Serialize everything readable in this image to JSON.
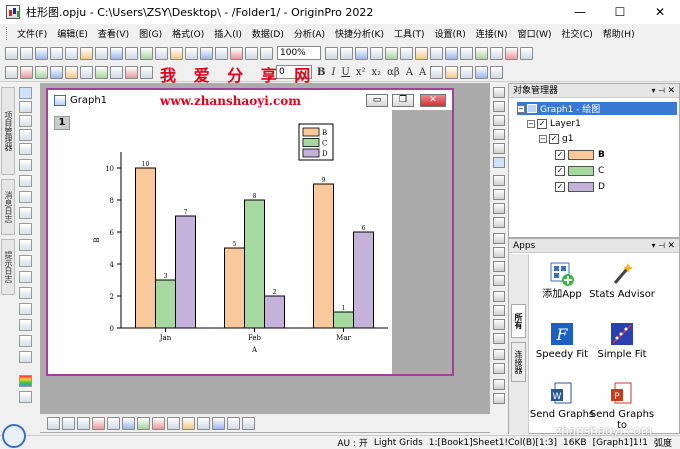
{
  "window": {
    "title": "柱形图.opju - C:\\Users\\ZSY\\Desktop\\ - /Folder1/ - OriginPro 2022",
    "min": "—",
    "max": "☐",
    "close": "✕"
  },
  "menu": [
    "文件(F)",
    "编辑(E)",
    "查看(V)",
    "图(G)",
    "格式(O)",
    "插入(I)",
    "数据(D)",
    "分析(A)",
    "快捷分析(K)",
    "工具(T)",
    "设置(R)",
    "连接(N)",
    "窗口(W)",
    "社交(C)",
    "帮助(H)"
  ],
  "toolbar": {
    "zoom": "100%",
    "font_size": "0"
  },
  "watermark": {
    "top": "我 爱 分 享 网",
    "url": "www.zhanshaoyi.com",
    "bottom": "zhanshaoyi.com"
  },
  "graph_window": {
    "title": "Graph1",
    "layer": "1",
    "min": "▭",
    "restore": "❐",
    "close": "✕"
  },
  "chart_data": {
    "type": "bar",
    "categories": [
      "Jan",
      "Feb",
      "Mar"
    ],
    "series": [
      {
        "name": "B",
        "values": [
          10,
          5,
          9
        ],
        "color": "#f9c89b"
      },
      {
        "name": "C",
        "values": [
          3,
          8,
          1
        ],
        "color": "#a6d9a0"
      },
      {
        "name": "D",
        "values": [
          7,
          2,
          6
        ],
        "color": "#c4b2db"
      }
    ],
    "xlabel": "A",
    "ylabel": "B",
    "ylim": [
      0,
      11
    ],
    "yticks": [
      0,
      2,
      4,
      6,
      8,
      10
    ],
    "legend": "top-right"
  },
  "object_manager": {
    "title": "对象管理器",
    "root": "Graph1 - 绘图",
    "layer": "Layer1",
    "group": "g1",
    "items": [
      {
        "name": "B",
        "color": "#f9c89b",
        "bold": true
      },
      {
        "name": "C",
        "color": "#a6d9a0",
        "bold": false
      },
      {
        "name": "D",
        "color": "#c4b2db",
        "bold": false
      }
    ]
  },
  "apps": {
    "title": "Apps",
    "tab_all": "所有",
    "tab_connectors": "连接器",
    "tiles": [
      {
        "label": "添加App",
        "icon": "add-app-icon"
      },
      {
        "label": "Stats Advisor",
        "icon": "magic-wand-icon"
      },
      {
        "label": "Speedy Fit",
        "icon": "speedy-fit-icon"
      },
      {
        "label": "Simple Fit",
        "icon": "simple-fit-icon"
      },
      {
        "label": "Send Graphs",
        "icon": "send-graphs-word-icon"
      },
      {
        "label": "Send Graphs to",
        "icon": "send-graphs-ppt-icon"
      }
    ]
  },
  "status": {
    "au": "AU : 开",
    "grid": "Light Grids",
    "cols": "1:[Book1]Sheet1!Col(B)[1:3]",
    "size": "16KB",
    "graph": "[Graph1]1!1",
    "unit": "弧度"
  }
}
